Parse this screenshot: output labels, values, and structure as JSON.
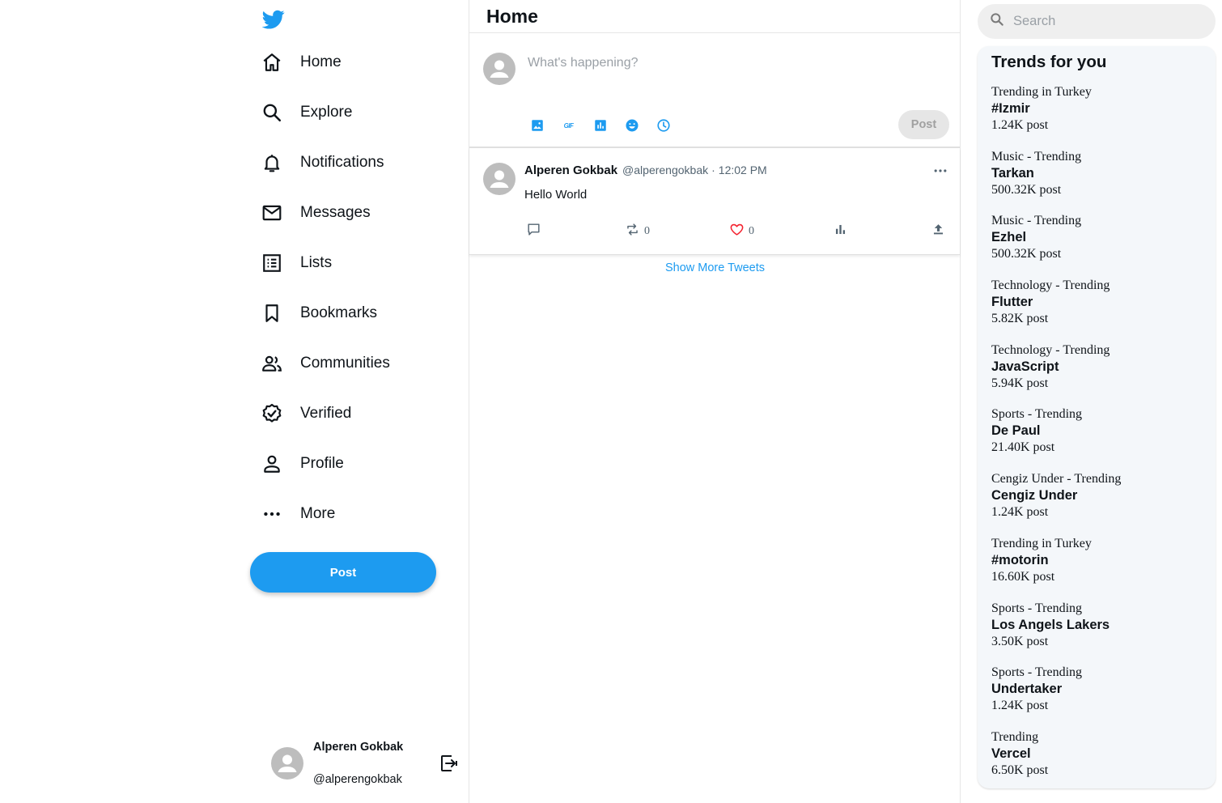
{
  "nav": {
    "items": [
      {
        "label": "Home",
        "icon": "home-icon"
      },
      {
        "label": "Explore",
        "icon": "search-icon"
      },
      {
        "label": "Notifications",
        "icon": "bell-icon"
      },
      {
        "label": "Messages",
        "icon": "mail-icon"
      },
      {
        "label": "Lists",
        "icon": "list-icon"
      },
      {
        "label": "Bookmarks",
        "icon": "bookmark-icon"
      },
      {
        "label": "Communities",
        "icon": "people-icon"
      },
      {
        "label": "Verified",
        "icon": "verified-icon"
      },
      {
        "label": "Profile",
        "icon": "person-icon"
      },
      {
        "label": "More",
        "icon": "more-icon"
      }
    ],
    "post_label": "Post"
  },
  "user": {
    "name": "Alperen Gokbak",
    "handle": "@alperengokbak"
  },
  "main": {
    "title": "Home",
    "composer": {
      "placeholder": "What's happening?",
      "post_label": "Post"
    },
    "tweet": {
      "name": "Alperen Gokbak",
      "handle": "@alperengokbak",
      "separator": "·",
      "time": "12:02 PM",
      "text": "Hello World",
      "retweets": "0",
      "likes": "0"
    },
    "show_more": "Show More Tweets"
  },
  "search": {
    "placeholder": "Search"
  },
  "trends": {
    "title": "Trends for you",
    "items": [
      {
        "category": "Trending in Turkey",
        "topic": "#Izmir",
        "count": "1.24K post"
      },
      {
        "category": "Music - Trending",
        "topic": "Tarkan",
        "count": "500.32K post"
      },
      {
        "category": "Music - Trending",
        "topic": "Ezhel",
        "count": "500.32K post"
      },
      {
        "category": "Technology - Trending",
        "topic": "Flutter",
        "count": "5.82K post"
      },
      {
        "category": "Technology - Trending",
        "topic": "JavaScript",
        "count": "5.94K post"
      },
      {
        "category": "Sports - Trending",
        "topic": "De Paul",
        "count": "21.40K post"
      },
      {
        "category": "Cengiz Under - Trending",
        "topic": "Cengiz Under",
        "count": "1.24K post"
      },
      {
        "category": "Trending in Turkey",
        "topic": "#motorin",
        "count": "16.60K post"
      },
      {
        "category": "Sports - Trending",
        "topic": "Los Angels Lakers",
        "count": "3.50K post"
      },
      {
        "category": "Sports - Trending",
        "topic": "Undertaker",
        "count": "1.24K post"
      },
      {
        "category": "Trending",
        "topic": "Vercel",
        "count": "6.50K post"
      }
    ]
  },
  "colors": {
    "brand": "#1d9bf0",
    "like": "#f4212e",
    "muted": "#536471"
  }
}
